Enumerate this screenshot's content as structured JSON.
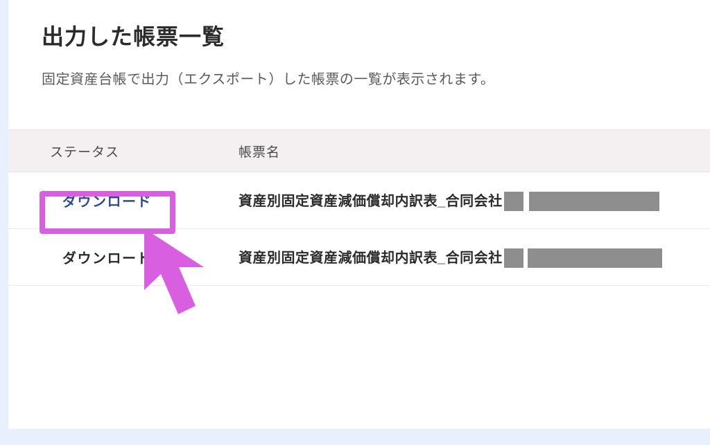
{
  "page": {
    "title": "出力した帳票一覧",
    "subtitle": "固定資産台帳で出力（エクスポート）した帳票の一覧が表示されます。"
  },
  "table": {
    "headers": {
      "status": "ステータス",
      "name": "帳票名"
    },
    "rows": [
      {
        "status_label": "ダウンロード",
        "status_is_link": true,
        "name_visible": "資産別固定資産減価償却内訳表_合同会社"
      },
      {
        "status_label": "ダウンロード",
        "status_is_link": false,
        "name_visible": "資産別固定資産減価償却内訳表_合同会社"
      }
    ]
  },
  "annotation": {
    "highlight_row": 0,
    "highlight_color": "#d85fe0"
  }
}
